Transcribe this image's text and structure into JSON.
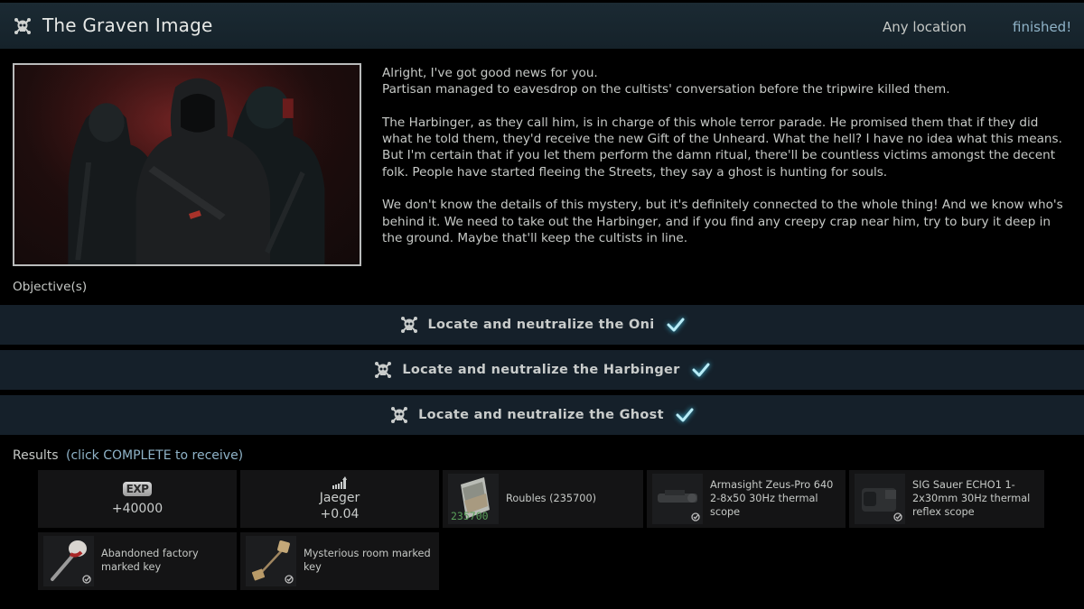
{
  "header": {
    "icon": "skull-icon",
    "title": "The Graven Image",
    "location": "Any location",
    "status": "finished!"
  },
  "quest_image": {
    "alt": "Three hooded cultist figures holding weapons against a dark red background"
  },
  "description": {
    "paragraphs": [
      "Alright, I've got good news for you.\nPartisan managed to eavesdrop on the cultists' conversation before the tripwire killed them.",
      "The Harbinger, as they call him, is in charge of this whole terror parade. He promised them that if they did what he told them, they'd receive the new Gift of the Unheard. What the hell? I have no idea what this means. But I'm certain that if you let them perform the damn ritual, there'll be countless victims amongst the decent folk. People have started fleeing the Streets, they say a ghost is hunting for souls.",
      "We don't know the details of this mystery, but it's definitely connected to the whole thing! And we know who's behind it. We need to take out the Harbinger, and if you find any creepy crap near him, try to bury it deep in the ground. Maybe that'll keep the cultists in line."
    ]
  },
  "objectives": {
    "label": "Objective(s)",
    "items": [
      {
        "icon": "skull-icon",
        "text": "Locate and neutralize the Oni",
        "completed": true
      },
      {
        "icon": "skull-icon",
        "text": "Locate and neutralize the Harbinger",
        "completed": true
      },
      {
        "icon": "skull-icon",
        "text": "Locate and neutralize the Ghost",
        "completed": true
      }
    ],
    "accent_color": "#3fc6e8"
  },
  "results": {
    "label": "Results",
    "hint": "(click COMPLETE to receive)",
    "rewards": [
      {
        "type": "experience",
        "badge": "EXP",
        "value": "+40000"
      },
      {
        "type": "reputation",
        "icon": "reputation-bars-icon",
        "trader": "Jaeger",
        "value": "+0.04"
      },
      {
        "type": "item",
        "icon": "roubles-icon",
        "name": "Roubles (235700)",
        "stack": "235700"
      },
      {
        "type": "item",
        "icon": "thermal-scope-icon",
        "name": "Armasight Zeus-Pro 640 2-8x50 30Hz thermal scope",
        "found_in_raid": true
      },
      {
        "type": "item",
        "icon": "thermal-sight-icon",
        "name": "SIG Sauer ECHO1 1-2x30mm 30Hz thermal reflex scope",
        "found_in_raid": true
      },
      {
        "type": "item",
        "icon": "key-icon",
        "name": "Abandoned factory marked key",
        "found_in_raid": true
      },
      {
        "type": "item",
        "icon": "key-icon",
        "name": "Mysterious room marked key",
        "found_in_raid": true
      }
    ]
  }
}
